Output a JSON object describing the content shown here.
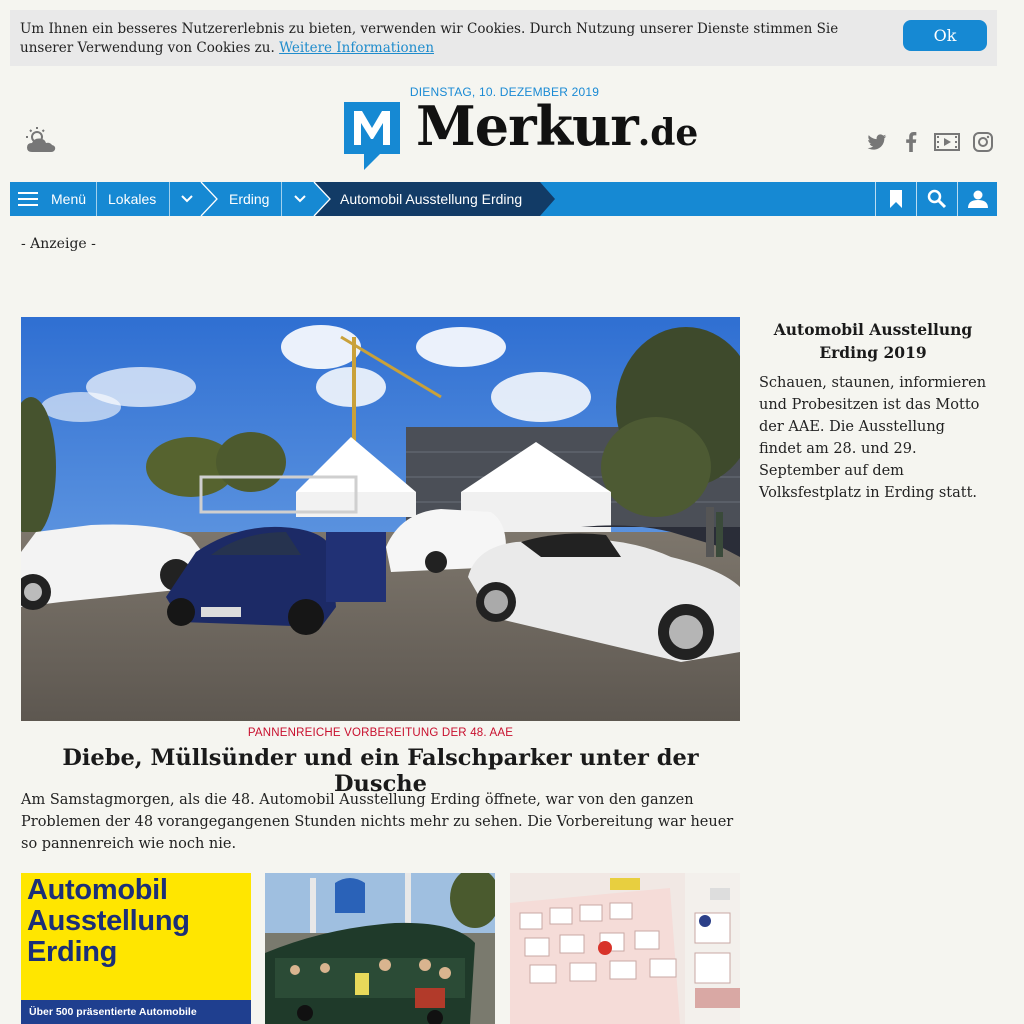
{
  "cookie": {
    "text": "Um Ihnen ein besseres Nutzererlebnis zu bieten, verwenden wir Cookies. Durch Nutzung unserer Dienste stimmen Sie unserer Verwendung von Cookies zu.",
    "link": "Weitere Informationen",
    "ok": "Ok"
  },
  "header": {
    "date": "DIENSTAG, 10. DEZEMBER 2019",
    "logo_main": "Merkur",
    "logo_tld": ".de",
    "weather_icon": "partly-cloudy-icon",
    "socials": [
      "twitter-icon",
      "facebook-icon",
      "video-icon",
      "instagram-icon"
    ]
  },
  "nav": {
    "menu": "Menü",
    "lokales": "Lokales",
    "erding": "Erding",
    "current": "Automobil Ausstellung Erding",
    "colors": {
      "bar": "#1689d3",
      "current": "#123b66"
    }
  },
  "ad_label": "- Anzeige -",
  "article": {
    "kicker": "PANNENREICHE VORBEREITUNG DER 48. AAE",
    "headline": "Diebe, Müllsünder und ein Falschparker unter der Dusche",
    "teaser": "Am Samstagmorgen, als die 48. Automobil Ausstellung Erding öffnete, war von den ganzen Problemen der 48 vorangegangenen Stunden nichts mehr zu sehen. Die Vorbereitung war heuer so pannenreich wie noch nie."
  },
  "sidebar": {
    "title": "Automobil Ausstellung Erding 2019",
    "text": "Schauen, staunen, informieren und Probesitzen ist das Motto der AAE. Die Ausstellung findet am 28. und 29. September auf dem Volksfestplatz in Erding statt."
  },
  "thumbs": {
    "aae_line1": "Automobil",
    "aae_line2": "Ausstellung",
    "aae_line3": "Erding",
    "aae_banner": "Über 500 präsentierte Automobile"
  }
}
